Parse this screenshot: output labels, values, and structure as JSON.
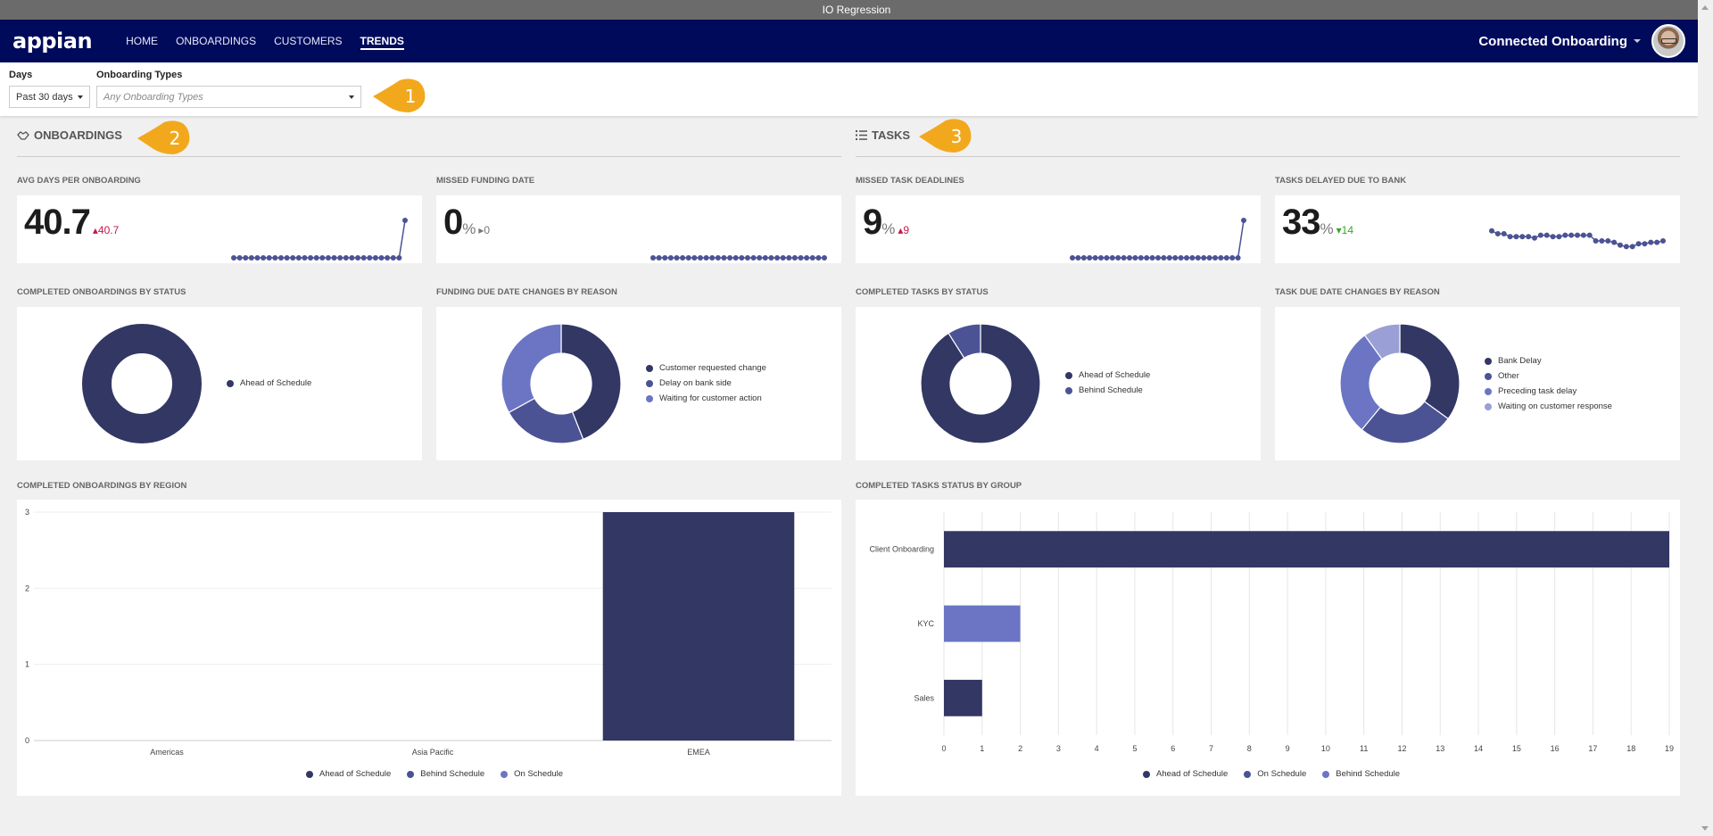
{
  "window": {
    "title": "IO Regression"
  },
  "nav": {
    "logo": "appian",
    "links": [
      {
        "label": "HOME",
        "active": false
      },
      {
        "label": "ONBOARDINGS",
        "active": false
      },
      {
        "label": "CUSTOMERS",
        "active": false
      },
      {
        "label": "TRENDS",
        "active": true
      }
    ],
    "site_name": "Connected Onboarding"
  },
  "filters": {
    "days": {
      "label": "Days",
      "value": "Past 30 days"
    },
    "types": {
      "label": "Onboarding Types",
      "placeholder": "Any Onboarding Types"
    }
  },
  "callouts": [
    "1",
    "2",
    "3"
  ],
  "colors": {
    "navy": "#000a5a",
    "series1": "#323764",
    "series2": "#4b5394",
    "series3": "#6b75c4",
    "series4": "#9a9fd6",
    "callout": "#f2a81d",
    "up": "#c7184b",
    "down": "#34a62d"
  },
  "sections": {
    "onboardings": {
      "title": "ONBOARDINGS",
      "icon": "handshake-icon"
    },
    "tasks": {
      "title": "TASKS",
      "icon": "list-icon"
    }
  },
  "kpis": [
    {
      "label": "AVG DAYS PER ONBOARDING",
      "value": "40.7",
      "unit": "",
      "delta": "40.7",
      "trend": "up",
      "spark": [
        0,
        0,
        0,
        0,
        0,
        0,
        0,
        0,
        0,
        0,
        0,
        0,
        0,
        0,
        0,
        0,
        0,
        0,
        0,
        0,
        0,
        0,
        0,
        0,
        0,
        0,
        0,
        0,
        0,
        40.7
      ]
    },
    {
      "label": "MISSED FUNDING DATE",
      "value": "0",
      "unit": "%",
      "delta": "0",
      "trend": "flat",
      "spark": [
        0,
        0,
        0,
        0,
        0,
        0,
        0,
        0,
        0,
        0,
        0,
        0,
        0,
        0,
        0,
        0,
        0,
        0,
        0,
        0,
        0,
        0,
        0,
        0,
        0,
        0,
        0,
        0,
        0,
        0
      ]
    },
    {
      "label": "MISSED TASK DEADLINES",
      "value": "9",
      "unit": "%",
      "delta": "9",
      "trend": "up",
      "spark": [
        0,
        0,
        0,
        0,
        0,
        0,
        0,
        0,
        0,
        0,
        0,
        0,
        0,
        0,
        0,
        0,
        0,
        0,
        0,
        0,
        0,
        0,
        0,
        0,
        0,
        0,
        0,
        0,
        0,
        0,
        9
      ]
    },
    {
      "label": "TASKS DELAYED DUE TO BANK",
      "value": "33",
      "unit": "%",
      "delta": "14",
      "trend": "down",
      "spark": [
        47,
        45,
        45,
        43,
        43,
        43,
        43,
        42,
        44,
        44,
        43,
        43,
        44,
        44,
        44,
        44,
        44,
        40,
        40,
        40,
        39,
        37,
        36,
        36,
        38,
        38,
        39,
        39,
        40
      ]
    }
  ],
  "chart_data": [
    {
      "type": "pie",
      "title": "COMPLETED ONBOARDINGS BY STATUS",
      "labels": [
        "Ahead of Schedule"
      ],
      "values": [
        100
      ],
      "colors": [
        "#323764"
      ]
    },
    {
      "type": "pie",
      "title": "FUNDING DUE DATE CHANGES BY REASON",
      "labels": [
        "Customer requested change",
        "Delay on bank side",
        "Waiting for customer action"
      ],
      "values": [
        44,
        23,
        33
      ],
      "colors": [
        "#323764",
        "#4b5394",
        "#6b75c4"
      ]
    },
    {
      "type": "pie",
      "title": "COMPLETED TASKS BY STATUS",
      "labels": [
        "Ahead of Schedule",
        "Behind Schedule"
      ],
      "values": [
        91,
        9
      ],
      "colors": [
        "#323764",
        "#4b5394"
      ]
    },
    {
      "type": "pie",
      "title": "TASK DUE DATE CHANGES BY REASON",
      "labels": [
        "Bank Delay",
        "Other",
        "Preceding task delay",
        "Waiting on customer response"
      ],
      "values": [
        35,
        26,
        29,
        10
      ],
      "colors": [
        "#323764",
        "#4b5394",
        "#6b75c4",
        "#9a9fd6"
      ]
    },
    {
      "type": "bar",
      "title": "COMPLETED ONBOARDINGS BY REGION",
      "categories": [
        "Americas",
        "Asia Pacific",
        "EMEA"
      ],
      "series": [
        {
          "name": "Ahead of Schedule",
          "values": [
            0,
            0,
            3
          ],
          "color": "#323764"
        },
        {
          "name": "Behind Schedule",
          "values": [
            0,
            0,
            0
          ],
          "color": "#4b5394"
        },
        {
          "name": "On Schedule",
          "values": [
            0,
            0,
            0
          ],
          "color": "#6b75c4"
        }
      ],
      "yticks": [
        "0",
        "1",
        "2",
        "3"
      ],
      "ylim": [
        0,
        3
      ],
      "grid": true,
      "legend": "bottom"
    },
    {
      "type": "bar",
      "orientation": "horizontal",
      "title": "COMPLETED TASKS STATUS BY GROUP",
      "categories": [
        "Client Onboarding",
        "KYC",
        "Sales"
      ],
      "series": [
        {
          "name": "Ahead of Schedule",
          "values": [
            19,
            0,
            1
          ],
          "color": "#323764"
        },
        {
          "name": "On Schedule",
          "values": [
            0,
            0,
            0
          ],
          "color": "#4b5394"
        },
        {
          "name": "Behind Schedule",
          "values": [
            0,
            2,
            0
          ],
          "color": "#6b75c4"
        }
      ],
      "xticks": [
        "0",
        "1",
        "2",
        "3",
        "4",
        "5",
        "6",
        "7",
        "8",
        "9",
        "10",
        "11",
        "12",
        "13",
        "14",
        "15",
        "16",
        "17",
        "18",
        "19"
      ],
      "xlim": [
        0,
        19
      ],
      "grid": true,
      "legend": "bottom"
    }
  ]
}
